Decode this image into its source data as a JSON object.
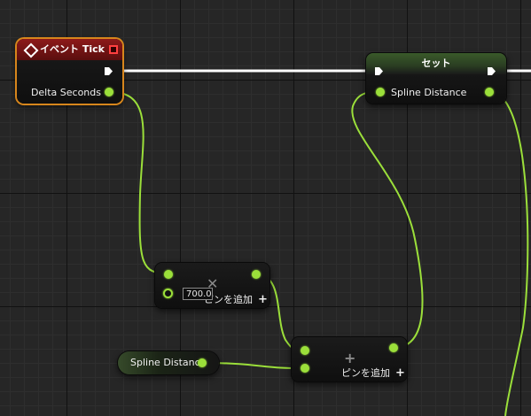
{
  "event_node": {
    "title": "イベント Tick",
    "output_label": "Delta Seconds",
    "header_color": "#8d1a1a",
    "outline_color": "#d7861c"
  },
  "set_node": {
    "title": "セット",
    "pin_label": "Spline Distance"
  },
  "multiply_node": {
    "operator_icon": "multiply-icon",
    "value": "700.0",
    "add_pin_label": "ピンを追加",
    "add_pin_icon": "plus-icon"
  },
  "add_node": {
    "operator_icon": "plus-icon",
    "add_pin_label": "ピンを追加",
    "add_pin_icon": "plus-icon"
  },
  "variable_node": {
    "label": "Spline Distance"
  },
  "colors": {
    "float_pin": "#9bdf3a",
    "exec_wire": "#ffffff",
    "grid_bg": "#262626"
  }
}
